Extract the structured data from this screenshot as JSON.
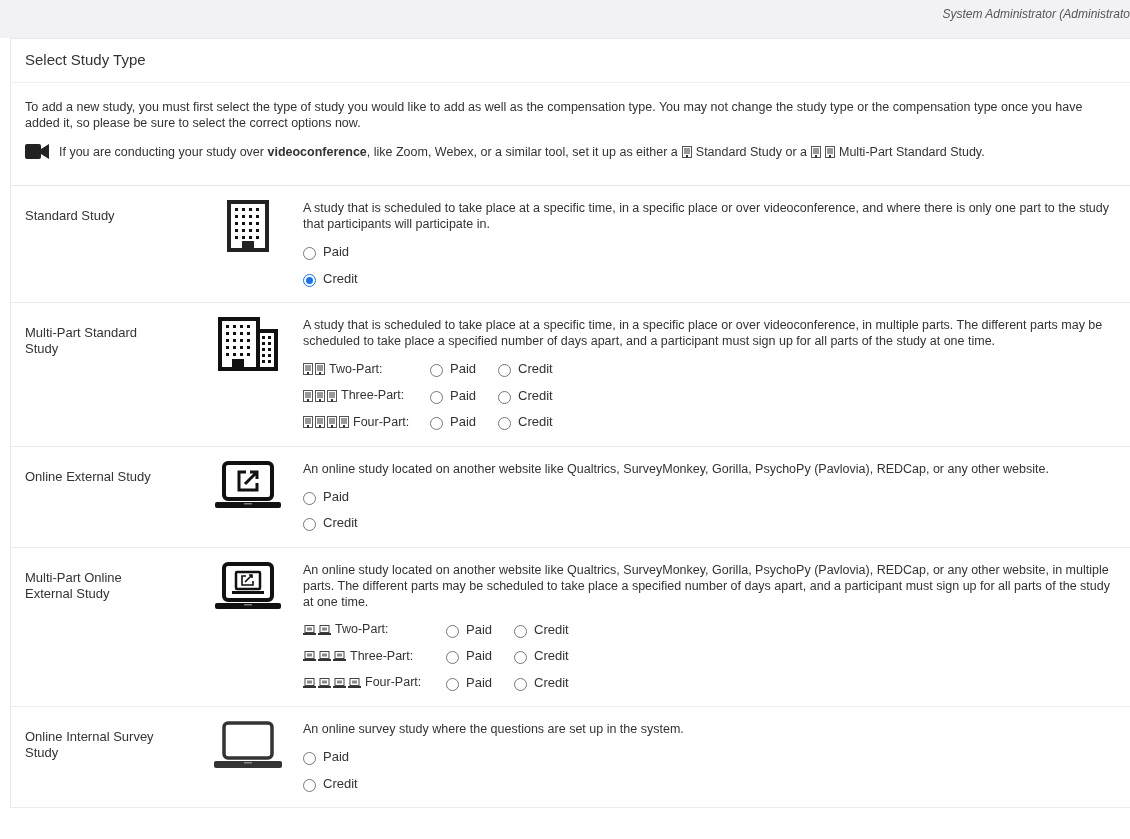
{
  "header": {
    "user": "System Administrator (Administrato"
  },
  "panel": {
    "title": "Select Study Type",
    "intro": "To add a new study, you must first select the type of study you would like to add as well as the compensation type. You may not change the study type or the compensation type once you have added it, so please be sure to select the correct options now.",
    "note": [
      {
        "kind": "text",
        "text": "If you are conducting your study over **videoconference**, like Zoom, Webex, or a similar tool, set it up as either a"
      },
      {
        "kind": "building"
      },
      {
        "kind": "text",
        "text": "Standard Study or a"
      },
      {
        "kind": "building"
      },
      {
        "kind": "building"
      },
      {
        "kind": "text",
        "text": "Multi-Part Standard Study."
      }
    ]
  },
  "studies": [
    {
      "name": "Standard Study",
      "kind": "simple",
      "description": "A study that is scheduled to take place at a specific time, in a specific place or over videoconference, and where there is only one part to the study that participants will participate in.",
      "options": [
        {
          "label": "Paid",
          "selected": false
        },
        {
          "label": "Credit",
          "selected": true
        }
      ]
    },
    {
      "name": "Multi-Part Standard Study",
      "kind": "multi",
      "description": "A study that is scheduled to take place at a specific time, in a specific place or over videoconference, in multiple parts. The different parts may be scheduled to take place a specified number of days apart, and a participant must sign up for all parts of the study at one time.",
      "parts": [
        {
          "label": "Two-Part:",
          "icons": [
            {
              "kind": "building"
            },
            {
              "kind": "building"
            }
          ],
          "options": [
            {
              "label": "Paid",
              "selected": false
            },
            {
              "label": "Credit",
              "selected": false
            }
          ]
        },
        {
          "label": "Three-Part:",
          "icons": [
            {
              "kind": "building"
            },
            {
              "kind": "building"
            },
            {
              "kind": "building"
            }
          ],
          "options": [
            {
              "label": "Paid",
              "selected": false
            },
            {
              "label": "Credit",
              "selected": false
            }
          ]
        },
        {
          "label": "Four-Part:",
          "icons": [
            {
              "kind": "building"
            },
            {
              "kind": "building"
            },
            {
              "kind": "building"
            },
            {
              "kind": "building"
            }
          ],
          "options": [
            {
              "label": "Paid",
              "selected": false
            },
            {
              "label": "Credit",
              "selected": false
            }
          ]
        }
      ]
    },
    {
      "name": "Online External Study",
      "kind": "simple",
      "description": "An online study located on another website like Qualtrics, SurveyMonkey, Gorilla, PsychoPy (Pavlovia), REDCap, or any other website.",
      "options": [
        {
          "label": "Paid",
          "selected": false
        },
        {
          "label": "Credit",
          "selected": false
        }
      ]
    },
    {
      "name": "Multi-Part Online External Study",
      "kind": "multi",
      "description": "An online study located on another website like Qualtrics, SurveyMonkey, Gorilla, PsychoPy (Pavlovia), REDCap, or any other website, in multiple parts. The different parts may be scheduled to take place a specified number of days apart, and a participant must sign up for all parts of the study at one time.",
      "parts": [
        {
          "label": "Two-Part:",
          "icons": [
            {
              "kind": "laptop"
            },
            {
              "kind": "laptop"
            }
          ],
          "options": [
            {
              "label": "Paid",
              "selected": false
            },
            {
              "label": "Credit",
              "selected": false
            }
          ]
        },
        {
          "label": "Three-Part:",
          "icons": [
            {
              "kind": "laptop"
            },
            {
              "kind": "laptop"
            },
            {
              "kind": "laptop"
            }
          ],
          "options": [
            {
              "label": "Paid",
              "selected": false
            },
            {
              "label": "Credit",
              "selected": false
            }
          ]
        },
        {
          "label": "Four-Part:",
          "icons": [
            {
              "kind": "laptop"
            },
            {
              "kind": "laptop"
            },
            {
              "kind": "laptop"
            },
            {
              "kind": "laptop"
            }
          ],
          "options": [
            {
              "label": "Paid",
              "selected": false
            },
            {
              "label": "Credit",
              "selected": false
            }
          ]
        }
      ]
    },
    {
      "name": "Online Internal Survey Study",
      "kind": "simple",
      "description": "An online survey study where the questions are set up in the system.",
      "options": [
        {
          "label": "Paid",
          "selected": false
        },
        {
          "label": "Credit",
          "selected": false
        }
      ]
    }
  ]
}
